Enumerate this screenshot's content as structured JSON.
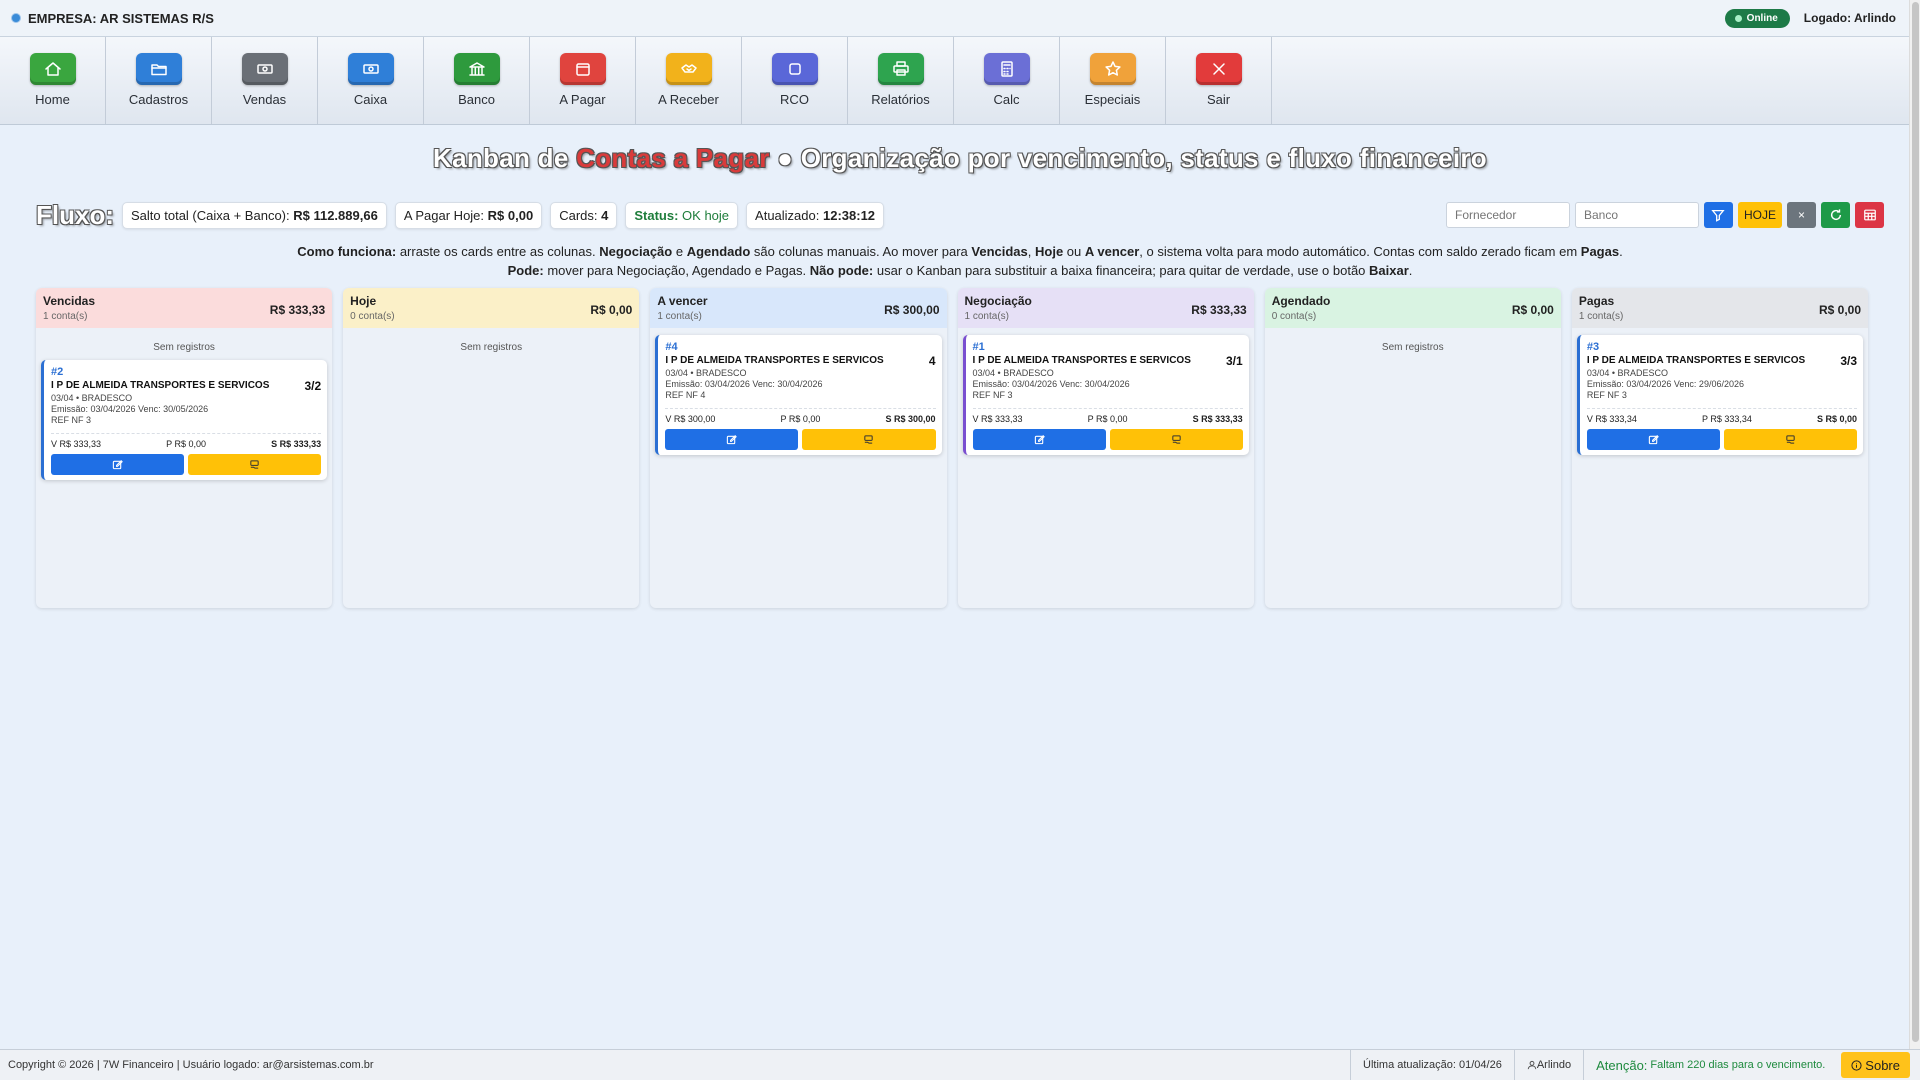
{
  "topbar": {
    "company": "EMPRESA: AR SISTEMAS R/S",
    "online": "Online",
    "logged": "Logado: Arlindo"
  },
  "toolbar": [
    {
      "label": "Home",
      "icon": "home-icon",
      "color": "#3aa63f"
    },
    {
      "label": "Cadastros",
      "icon": "folder-icon",
      "color": "#2f7fd8"
    },
    {
      "label": "Vendas",
      "icon": "cash-icon",
      "color": "#6a6f76"
    },
    {
      "label": "Caixa",
      "icon": "cash-register-icon",
      "color": "#2f7fd8"
    },
    {
      "label": "Banco",
      "icon": "bank-icon",
      "color": "#2e9a3d"
    },
    {
      "label": "A Pagar",
      "icon": "wallet-icon",
      "color": "#e0443e"
    },
    {
      "label": "A Receber",
      "icon": "handshake-icon",
      "color": "#f2b21b"
    },
    {
      "label": "RCO",
      "icon": "square-icon",
      "color": "#5a67d8"
    },
    {
      "label": "Relatórios",
      "icon": "printer-icon",
      "color": "#2ea44f"
    },
    {
      "label": "Calc",
      "icon": "calculator-icon",
      "color": "#6b6fd6"
    },
    {
      "label": "Especiais",
      "icon": "star-icon",
      "color": "#f0a23a"
    },
    {
      "label": "Sair",
      "icon": "close-icon",
      "color": "#e23b3b"
    }
  ],
  "title": {
    "prefix": "Kanban de ",
    "highlight": "Contas a Pagar",
    "suffix": " ● Organização por vencimento, status e fluxo financeiro"
  },
  "flux": {
    "label": "Fluxo:",
    "saldo_label": "Salto total (Caixa + Banco):",
    "saldo_value": "R$ 112.889,66",
    "hoje_label": "A Pagar Hoje:",
    "hoje_value": "R$ 0,00",
    "cards_label": "Cards:",
    "cards_value": "4",
    "status_label": "Status:",
    "status_value": "OK hoje",
    "atualizado_label": "Atualizado:",
    "atualizado_value": "12:38:12"
  },
  "filters": {
    "fornecedor_placeholder": "Fornecedor",
    "banco_placeholder": "Banco",
    "hoje_button": "HOJE",
    "clear_button": "×"
  },
  "help": {
    "l1_a": "Como funciona:",
    "l1_b": " arraste os cards entre as colunas. ",
    "l1_c": "Negociação",
    "l1_d": " e ",
    "l1_e": "Agendado",
    "l1_f": " são colunas manuais. Ao mover para ",
    "l1_g": "Vencidas",
    "l1_h": ", ",
    "l1_i": "Hoje",
    "l1_j": " ou ",
    "l1_k": "A vencer",
    "l1_l": ", o sistema volta para modo automático. Contas com saldo zerado ficam em ",
    "l1_m": "Pagas",
    "l1_n": ".",
    "l2_a": "Pode:",
    "l2_b": " mover para Negociação, Agendado e Pagas. ",
    "l2_c": "Não pode:",
    "l2_d": " usar o Kanban para substituir a baixa financeira; para quitar de verdade, use o botão ",
    "l2_e": "Baixar",
    "l2_f": "."
  },
  "columns": [
    {
      "title": "Vencidas",
      "count": "1 conta(s)",
      "total": "R$ 333,33",
      "color": "#fbdcdc",
      "empty": "Sem registros",
      "cards": [
        {
          "num": "#2",
          "name": "I P DE ALMEIDA TRANSPORTES E SERVICOS",
          "parcela": "3/2",
          "line1": "03/04 • BRADESCO",
          "line2": "Emissão: 03/04/2026 Venc: 30/05/2026",
          "line3": "REF NF 3",
          "v": "V R$ 333,33",
          "p": "P R$ 0,00",
          "s": "S R$ 333,33",
          "border": "#2b6fd3"
        }
      ]
    },
    {
      "title": "Hoje",
      "count": "0 conta(s)",
      "total": "R$ 0,00",
      "color": "#fbf0c8",
      "empty": "Sem registros",
      "cards": []
    },
    {
      "title": "A vencer",
      "count": "1 conta(s)",
      "total": "R$ 300,00",
      "color": "#d8e7fb",
      "empty": "",
      "cards": [
        {
          "num": "#4",
          "name": "I P DE ALMEIDA TRANSPORTES E SERVICOS",
          "parcela": "4",
          "line1": "03/04 • BRADESCO",
          "line2": "Emissão: 03/04/2026 Venc: 30/04/2026",
          "line3": "REF NF 4",
          "v": "V R$ 300,00",
          "p": "P R$ 0,00",
          "s": "S R$ 300,00",
          "border": "#2b6fd3"
        }
      ]
    },
    {
      "title": "Negociação",
      "count": "1 conta(s)",
      "total": "R$ 333,33",
      "color": "#e6e0f6",
      "empty": "",
      "cards": [
        {
          "num": "#1",
          "name": "I P DE ALMEIDA TRANSPORTES E SERVICOS",
          "parcela": "3/1",
          "line1": "03/04 • BRADESCO",
          "line2": "Emissão: 03/04/2026 Venc: 30/04/2026",
          "line3": "REF NF 3",
          "v": "V R$ 333,33",
          "p": "P R$ 0,00",
          "s": "S R$ 333,33",
          "border": "#7a4fd0"
        }
      ]
    },
    {
      "title": "Agendado",
      "count": "0 conta(s)",
      "total": "R$ 0,00",
      "color": "#d9f3e2",
      "empty": "Sem registros",
      "cards": []
    },
    {
      "title": "Pagas",
      "count": "1 conta(s)",
      "total": "R$ 0,00",
      "color": "#e4e6ea",
      "empty": "",
      "cards": [
        {
          "num": "#3",
          "name": "I P DE ALMEIDA TRANSPORTES E SERVICOS",
          "parcela": "3/3",
          "line1": "03/04 • BRADESCO",
          "line2": "Emissão: 03/04/2026 Venc: 29/06/2026",
          "line3": "REF NF 3",
          "v": "V R$ 333,34",
          "p": "P R$ 333,34",
          "s": "S R$ 0,00",
          "border": "#2b6fd3"
        }
      ]
    }
  ],
  "statusbar": {
    "copyright": "Copyright © 2026 | 7W Financeiro | Usuário logado: ar@arsistemas.com.br",
    "ultima": "Última atualização: 01/04/26",
    "user": "Arlindo",
    "atencao_label": "Atenção:",
    "atencao_text": "Faltam 220 dias para o vencimento.",
    "sobre": "Sobre"
  }
}
